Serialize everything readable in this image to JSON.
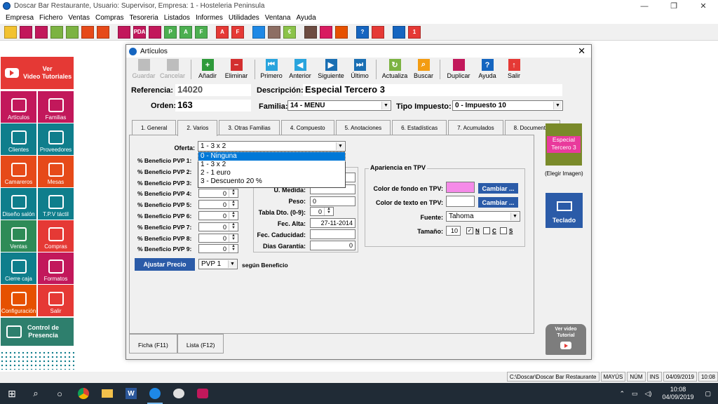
{
  "app": {
    "title": "Doscar Bar Restaurante, Usuario: Supervisor, Empresa: 1 - Hosteleria Peninsula",
    "window_controls": [
      "—",
      "❐",
      "✕"
    ]
  },
  "menu": [
    "Empresa",
    "Fichero",
    "Ventas",
    "Compras",
    "Tesoreria",
    "Listados",
    "Informes",
    "Utilidades",
    "Ventana",
    "Ayuda"
  ],
  "toolbar_icons": [
    {
      "name": "new-doc-icon",
      "color": "#f2c230",
      "glyph": ""
    },
    {
      "name": "people-icon",
      "color": "#c2185b",
      "glyph": ""
    },
    {
      "name": "org-icon",
      "color": "#c2185b",
      "glyph": ""
    },
    {
      "name": "smile-icon",
      "color": "#7cb342",
      "glyph": ""
    },
    {
      "name": "doc-green-icon",
      "color": "#7cb342",
      "glyph": ""
    },
    {
      "name": "waiters-icon",
      "color": "#e64a19",
      "glyph": ""
    },
    {
      "name": "tables-icon",
      "color": "#e64a19",
      "glyph": ""
    },
    {
      "name": "sep",
      "color": "",
      "glyph": ""
    },
    {
      "name": "screen-icon",
      "color": "#c2185b",
      "glyph": ""
    },
    {
      "name": "pda-icon",
      "color": "#c2185b",
      "glyph": "PDA"
    },
    {
      "name": "pie-icon",
      "color": "#c2185b",
      "glyph": ""
    },
    {
      "name": "p-icon",
      "color": "#4caf50",
      "glyph": "P"
    },
    {
      "name": "a-icon",
      "color": "#4caf50",
      "glyph": "A"
    },
    {
      "name": "f-icon",
      "color": "#4caf50",
      "glyph": "F"
    },
    {
      "name": "sep",
      "color": "",
      "glyph": ""
    },
    {
      "name": "a-red-icon",
      "color": "#e53935",
      "glyph": "A"
    },
    {
      "name": "f-red-icon",
      "color": "#e53935",
      "glyph": "F"
    },
    {
      "name": "sep",
      "color": "",
      "glyph": ""
    },
    {
      "name": "safe-icon",
      "color": "#1e88e5",
      "glyph": ""
    },
    {
      "name": "doc-icon",
      "color": "#8d6e63",
      "glyph": ""
    },
    {
      "name": "euro-icon",
      "color": "#8bc34a",
      "glyph": "€"
    },
    {
      "name": "sep",
      "color": "",
      "glyph": ""
    },
    {
      "name": "phone-icon",
      "color": "#6d4c41",
      "glyph": ""
    },
    {
      "name": "settings-icon",
      "color": "#d81b60",
      "glyph": ""
    },
    {
      "name": "calc-icon",
      "color": "#e65100",
      "glyph": ""
    },
    {
      "name": "sep",
      "color": "",
      "glyph": ""
    },
    {
      "name": "help-icon",
      "color": "#1565c0",
      "glyph": "?"
    },
    {
      "name": "exit-icon",
      "color": "#e53935",
      "glyph": ""
    },
    {
      "name": "sep",
      "color": "",
      "glyph": ""
    },
    {
      "name": "tools-icon",
      "color": "#1565c0",
      "glyph": ""
    },
    {
      "name": "star-icon",
      "color": "#e53935",
      "glyph": "1"
    }
  ],
  "left_panel": {
    "video_label": "Ver\nVideo Tutoriales",
    "tiles": [
      {
        "label": "Artículos",
        "color": "#c2185b",
        "name": "articulos"
      },
      {
        "label": "Familias",
        "color": "#c2185b",
        "name": "familias"
      },
      {
        "label": "Clientes",
        "color": "#0f7e8c",
        "name": "clientes"
      },
      {
        "label": "Proveedores",
        "color": "#0f7e8c",
        "name": "proveedores"
      },
      {
        "label": "Camareros",
        "color": "#e64a19",
        "name": "camareros"
      },
      {
        "label": "Mesas",
        "color": "#e64a19",
        "name": "mesas"
      },
      {
        "label": "Diseño salón",
        "color": "#0f7e8c",
        "name": "diseno-salon"
      },
      {
        "label": "T.P.V táctil",
        "color": "#0f7e8c",
        "name": "tpv-tactil"
      },
      {
        "label": "Ventas",
        "color": "#2e8b57",
        "name": "ventas"
      },
      {
        "label": "Compras",
        "color": "#e53935",
        "name": "compras"
      },
      {
        "label": "Cierre caja",
        "color": "#0f7e8c",
        "name": "cierre-caja"
      },
      {
        "label": "Formatos",
        "color": "#c2185b",
        "name": "formatos"
      },
      {
        "label": "Configuración",
        "color": "#e65100",
        "name": "configuracion"
      },
      {
        "label": "Salir",
        "color": "#e53935",
        "name": "salir"
      }
    ],
    "control_presencia": "Control de\nPresencia"
  },
  "dialog": {
    "title": "Artículos",
    "close": "✕",
    "toolbar": [
      {
        "label": "Guardar",
        "disabled": true,
        "color": "#9e9e9e",
        "glyph": ""
      },
      {
        "label": "Cancelar",
        "disabled": true,
        "color": "#9e9e9e",
        "glyph": ""
      },
      {
        "sep": true
      },
      {
        "label": "Añadir",
        "disabled": false,
        "color": "#2e9a3a",
        "glyph": "+"
      },
      {
        "label": "Eliminar",
        "disabled": false,
        "color": "#d32f2f",
        "glyph": "−"
      },
      {
        "sep": true
      },
      {
        "label": "Primero",
        "disabled": false,
        "color": "#29a4dd",
        "glyph": "⏮"
      },
      {
        "label": "Anterior",
        "disabled": false,
        "color": "#29a4dd",
        "glyph": "◀"
      },
      {
        "label": "Siguiente",
        "disabled": false,
        "color": "#1a6fb3",
        "glyph": "▶"
      },
      {
        "label": "Último",
        "disabled": false,
        "color": "#1a6fb3",
        "glyph": "⏭"
      },
      {
        "sep": true
      },
      {
        "label": "Actualiza",
        "disabled": false,
        "color": "#7cb342",
        "glyph": "↻"
      },
      {
        "label": "Buscar",
        "disabled": false,
        "color": "#f39c12",
        "glyph": "⌕"
      },
      {
        "sep": true
      },
      {
        "label": "Duplicar",
        "disabled": false,
        "color": "#c2185b",
        "glyph": ""
      },
      {
        "label": "Ayuda",
        "disabled": false,
        "color": "#1565c0",
        "glyph": "?"
      },
      {
        "label": "Salir",
        "disabled": false,
        "color": "#e53935",
        "glyph": "↑"
      }
    ],
    "referencia_label": "Referencia:",
    "referencia_value": "14020",
    "descripcion_label": "Descripción:",
    "descripcion_value": "Especial Tercero 3",
    "orden_label": "Orden:",
    "orden_value": "163",
    "familia_label": "Familia:",
    "familia_value": "14 - MENU",
    "tipo_impuesto_label": "Tipo Impuesto:",
    "tipo_impuesto_value": "0 - Impuesto 10",
    "tabs": [
      {
        "label": "1. General",
        "active": false
      },
      {
        "label": "2. Varios",
        "active": true
      },
      {
        "label": "3. Otras Familias",
        "active": false
      },
      {
        "label": "4. Compuesto",
        "active": false
      },
      {
        "label": "5. Anotaciones",
        "active": false
      },
      {
        "label": "6. Estadísticas",
        "active": false
      },
      {
        "label": "7. Acumulados",
        "active": false
      },
      {
        "label": "8. Documentos",
        "active": false
      }
    ],
    "oferta_label": "Oferta:",
    "oferta_value": "1 - 3 x 2",
    "oferta_options": [
      {
        "label": "0 - Ninguna",
        "selected": true
      },
      {
        "label": "1 - 3 x 2",
        "selected": false
      },
      {
        "label": "2 - 1 euro",
        "selected": false
      },
      {
        "label": "3 - Descuento 20 %",
        "selected": false
      }
    ],
    "beneficios": [
      {
        "label": "% Beneficio PVP 1:",
        "value": "0"
      },
      {
        "label": "% Beneficio PVP 2:",
        "value": "0"
      },
      {
        "label": "% Beneficio PVP 3:",
        "value": "0"
      },
      {
        "label": "% Beneficio PVP 4:",
        "value": "0"
      },
      {
        "label": "% Beneficio PVP 5:",
        "value": "0"
      },
      {
        "label": "% Beneficio PVP 6:",
        "value": "0"
      },
      {
        "label": "% Beneficio PVP 7:",
        "value": "0"
      },
      {
        "label": "% Beneficio PVP 8:",
        "value": "0"
      },
      {
        "label": "% Beneficio PVP 9:",
        "value": "0"
      }
    ],
    "medidas": {
      "unidad_medida_label": "U. Medida:",
      "unidad_medida_value": "",
      "peso_label": "Peso:",
      "peso_value": "0",
      "tabla_dto_label": "Tabla Dto. (0-9):",
      "tabla_dto_value": "0",
      "fec_alta_label": "Fec. Alta:",
      "fec_alta_value": "27-11-2014",
      "fec_caducidad_label": "Fec. Caducidad:",
      "fec_caducidad_value": "",
      "dias_garantia_label": "Dias Garantía:",
      "dias_garantia_value": "0"
    },
    "apariencia": {
      "title": "Apariencia en TPV",
      "color_fondo_label": "Color de fondo en TPV:",
      "color_fondo": "#f58ae8",
      "color_texto_label": "Color de texto en TPV:",
      "color_texto": "#ffffff",
      "cambiar_label": "Cambiar ...",
      "fuente_label": "Fuente:",
      "fuente_value": "Tahoma",
      "tamano_label": "Tamaño:",
      "tamano_value": "10",
      "checks": [
        {
          "label": "N",
          "checked": true
        },
        {
          "label": "C",
          "checked": false
        },
        {
          "label": "S",
          "checked": false
        }
      ]
    },
    "ajustar_precio_label": "Ajustar Precio",
    "pvp_select_value": "PVP 1",
    "segun_beneficio": "según Beneficio",
    "image_caption": "Especial Tercero 3",
    "elegir_imagen": "(Elegir Imagen)",
    "teclado_label": "Teclado",
    "ver_video": "Ver video Tutorial",
    "bottom_tabs": [
      "Ficha (F11)",
      "Lista (F12)"
    ]
  },
  "statusbar": [
    "C:\\Doscar\\Doscar Bar Restaurante",
    "MAYÚS",
    "NÚM",
    "INS",
    "04/09/2019",
    "10:08"
  ],
  "taskbar": {
    "time": "10:08",
    "date": "04/09/2019"
  }
}
